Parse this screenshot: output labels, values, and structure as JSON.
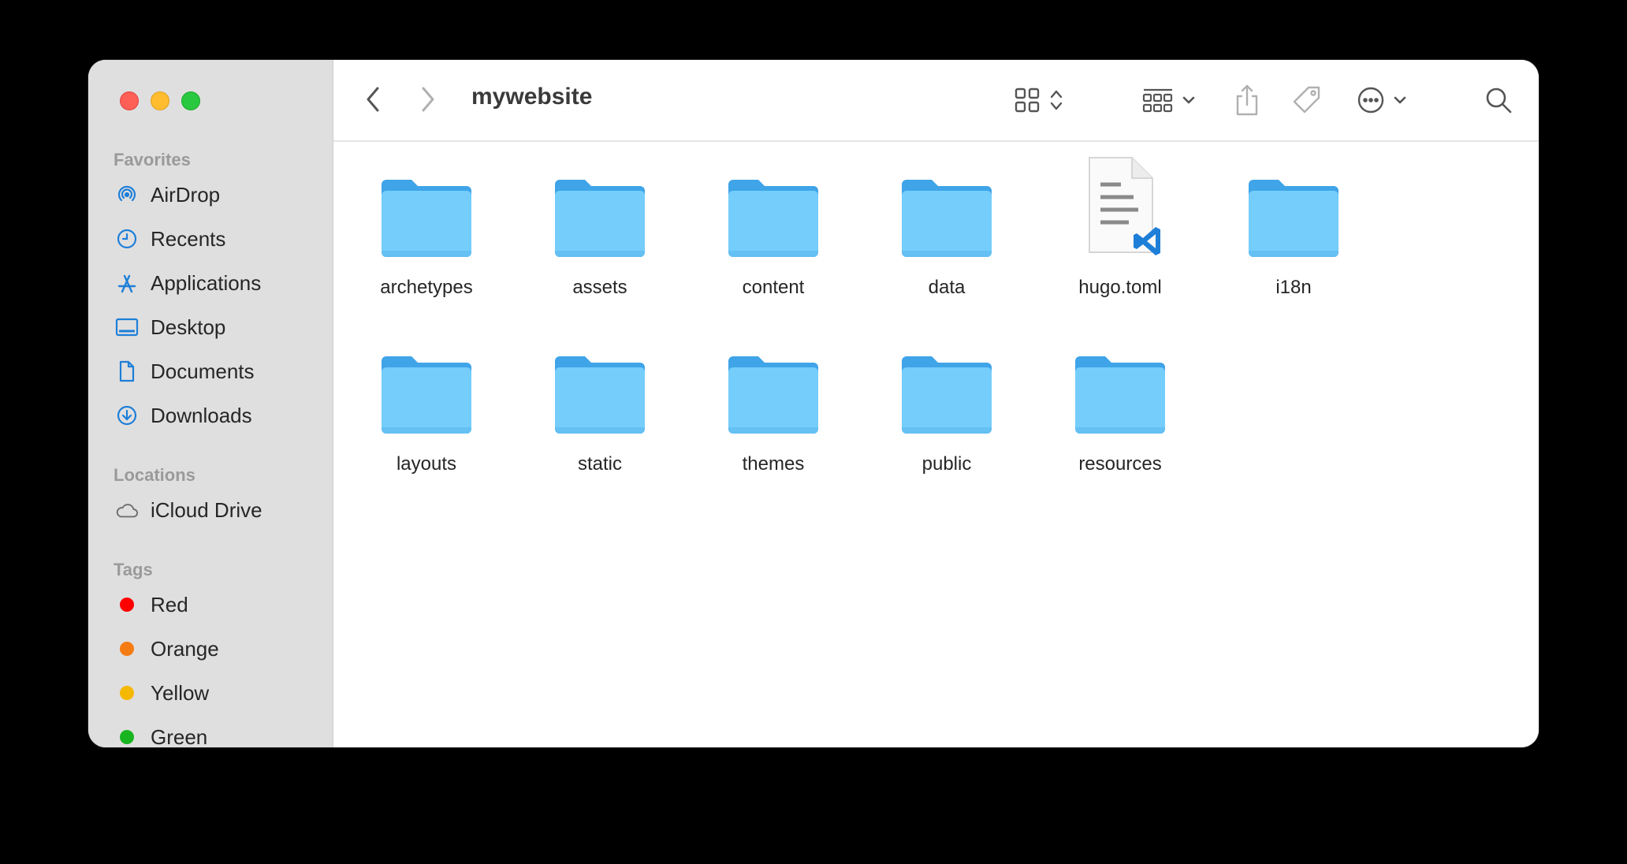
{
  "window": {
    "title": "mywebsite"
  },
  "sidebar": {
    "sections": [
      {
        "label": "Favorites"
      },
      {
        "label": "Locations"
      },
      {
        "label": "Tags"
      }
    ],
    "favorites": [
      {
        "label": "AirDrop",
        "icon": "airdrop-icon"
      },
      {
        "label": "Recents",
        "icon": "clock-icon"
      },
      {
        "label": "Applications",
        "icon": "applications-icon"
      },
      {
        "label": "Desktop",
        "icon": "desktop-icon"
      },
      {
        "label": "Documents",
        "icon": "document-icon"
      },
      {
        "label": "Downloads",
        "icon": "download-icon"
      }
    ],
    "locations": [
      {
        "label": "iCloud Drive",
        "icon": "cloud-icon"
      }
    ],
    "tags": [
      {
        "label": "Red",
        "color": "#fe0000"
      },
      {
        "label": "Orange",
        "color": "#f57c13"
      },
      {
        "label": "Yellow",
        "color": "#f5b800"
      },
      {
        "label": "Green",
        "color": "#18b521"
      }
    ]
  },
  "colors": {
    "accent": "#1e7fd8",
    "folder_body": "#74cdfb",
    "folder_back": "#3fa4e8"
  },
  "items": [
    {
      "name": "archetypes",
      "kind": "folder"
    },
    {
      "name": "assets",
      "kind": "folder"
    },
    {
      "name": "content",
      "kind": "folder"
    },
    {
      "name": "data",
      "kind": "folder"
    },
    {
      "name": "hugo.toml",
      "kind": "file"
    },
    {
      "name": "i18n",
      "kind": "folder"
    },
    {
      "name": "layouts",
      "kind": "folder"
    },
    {
      "name": "static",
      "kind": "folder"
    },
    {
      "name": "themes",
      "kind": "folder"
    },
    {
      "name": "public",
      "kind": "folder"
    },
    {
      "name": "resources",
      "kind": "folder"
    }
  ]
}
